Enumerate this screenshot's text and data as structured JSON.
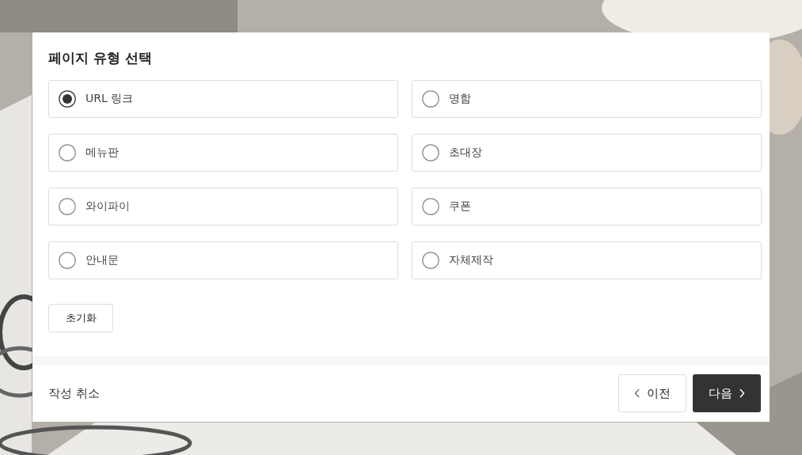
{
  "dialog": {
    "title": "페이지 유형 선택",
    "options": [
      {
        "label": "URL 링크",
        "selected": true
      },
      {
        "label": "명함",
        "selected": false
      },
      {
        "label": "메뉴판",
        "selected": false
      },
      {
        "label": "초대장",
        "selected": false
      },
      {
        "label": "와이파이",
        "selected": false
      },
      {
        "label": "쿠폰",
        "selected": false
      },
      {
        "label": "안내문",
        "selected": false
      },
      {
        "label": "자체제작",
        "selected": false
      }
    ],
    "reset_button": "초기화"
  },
  "footer": {
    "cancel_link": "작성 취소",
    "prev_button": "이전",
    "next_button": "다음"
  }
}
